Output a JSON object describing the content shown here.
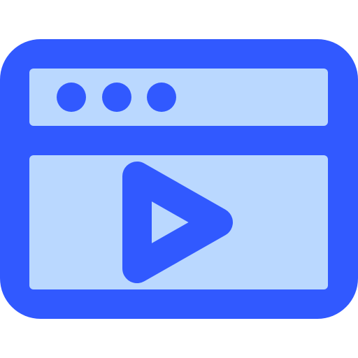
{
  "icon": {
    "name": "browser-video-play-icon",
    "colors": {
      "stroke": "#3159FF",
      "fill": "#BAD8FF",
      "background": "#FFFFFF"
    },
    "window_dots_count": 3
  }
}
